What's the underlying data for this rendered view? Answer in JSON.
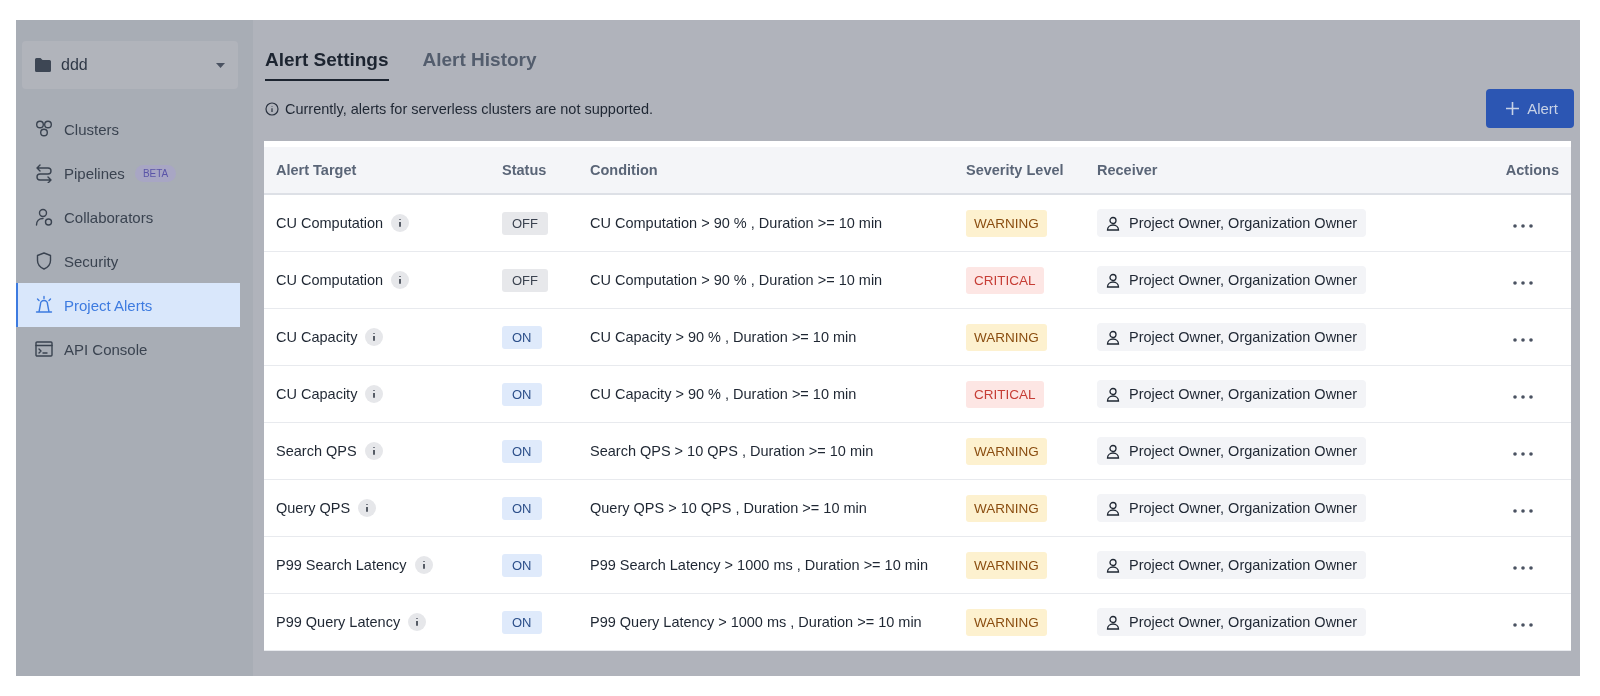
{
  "sidebar": {
    "project": {
      "name": "ddd"
    },
    "items": [
      {
        "kind": "clusters",
        "label": "Clusters",
        "selected": false
      },
      {
        "kind": "pipelines",
        "label": "Pipelines",
        "badge": "BETA",
        "selected": false
      },
      {
        "kind": "collaborators",
        "label": "Collaborators",
        "selected": false
      },
      {
        "kind": "security",
        "label": "Security",
        "selected": false
      },
      {
        "kind": "alerts",
        "label": "Project Alerts",
        "selected": true
      },
      {
        "kind": "console",
        "label": "API Console",
        "selected": false
      }
    ]
  },
  "tabs": [
    {
      "label": "Alert Settings",
      "selected": true
    },
    {
      "label": "Alert History",
      "selected": false
    }
  ],
  "notice": "Currently, alerts for serverless clusters are not supported.",
  "add_button": {
    "label": "Alert"
  },
  "table": {
    "columns": [
      "Alert Target",
      "Status",
      "Condition",
      "Severity Level",
      "Receiver",
      "Actions"
    ],
    "rows": [
      {
        "target": "CU Computation",
        "status": {
          "label": "OFF",
          "on": false
        },
        "condition": "CU Computation > 90 % , Duration >= 10 min",
        "severity": {
          "label": "WARNING",
          "kind": "warning"
        },
        "receiver": "Project Owner, Organization Owner"
      },
      {
        "target": "CU Computation",
        "status": {
          "label": "OFF",
          "on": false
        },
        "condition": "CU Computation > 90 % , Duration >= 10 min",
        "severity": {
          "label": "CRITICAL",
          "kind": "critical"
        },
        "receiver": "Project Owner, Organization Owner"
      },
      {
        "target": "CU Capacity",
        "status": {
          "label": "ON",
          "on": true
        },
        "condition": "CU Capacity > 90 % , Duration >= 10 min",
        "severity": {
          "label": "WARNING",
          "kind": "warning"
        },
        "receiver": "Project Owner, Organization Owner"
      },
      {
        "target": "CU Capacity",
        "status": {
          "label": "ON",
          "on": true
        },
        "condition": "CU Capacity > 90 % , Duration >= 10 min",
        "severity": {
          "label": "CRITICAL",
          "kind": "critical"
        },
        "receiver": "Project Owner, Organization Owner"
      },
      {
        "target": "Search QPS",
        "status": {
          "label": "ON",
          "on": true
        },
        "condition": "Search QPS > 10 QPS , Duration >= 10 min",
        "severity": {
          "label": "WARNING",
          "kind": "warning"
        },
        "receiver": "Project Owner, Organization Owner"
      },
      {
        "target": "Query QPS",
        "status": {
          "label": "ON",
          "on": true
        },
        "condition": "Query QPS > 10 QPS , Duration >= 10 min",
        "severity": {
          "label": "WARNING",
          "kind": "warning"
        },
        "receiver": "Project Owner, Organization Owner"
      },
      {
        "target": "P99 Search Latency",
        "status": {
          "label": "ON",
          "on": true
        },
        "condition": "P99 Search Latency > 1000 ms , Duration >= 10 min",
        "severity": {
          "label": "WARNING",
          "kind": "warning"
        },
        "receiver": "Project Owner, Organization Owner"
      },
      {
        "target": "P99 Query Latency",
        "status": {
          "label": "ON",
          "on": true
        },
        "condition": "P99 Query Latency > 1000 ms , Duration >= 10 min",
        "severity": {
          "label": "WARNING",
          "kind": "warning"
        },
        "receiver": "Project Owner, Organization Owner"
      }
    ]
  }
}
